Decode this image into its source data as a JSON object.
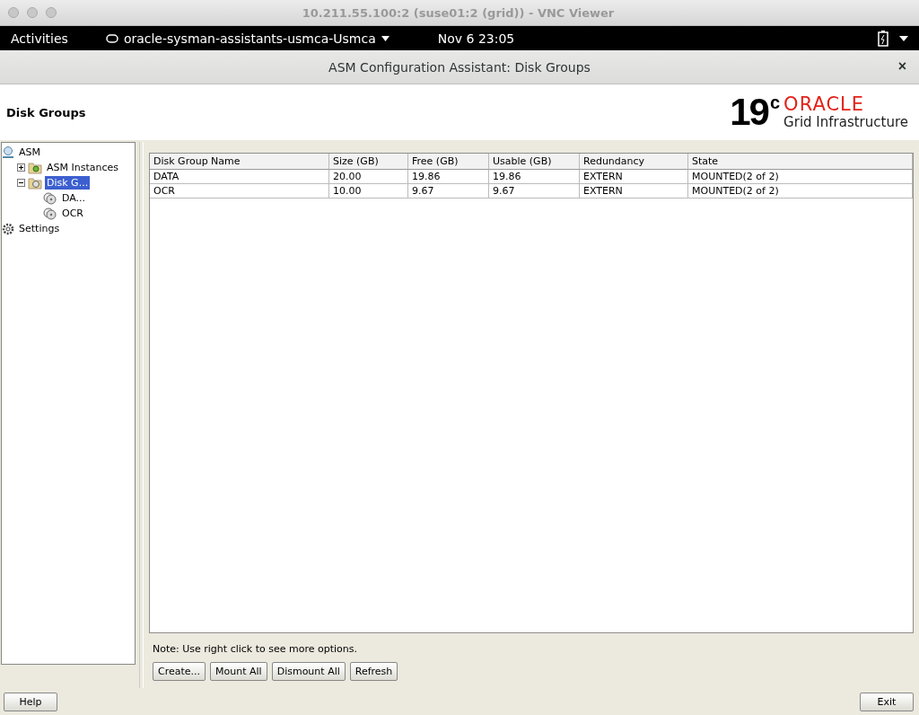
{
  "vnc_window": {
    "title": "10.211.55.100:2 (suse01:2 (grid)) - VNC Viewer"
  },
  "top_bar": {
    "activities": "Activities",
    "app_menu": "oracle-sysman-assistants-usmca-Usmca",
    "clock": "Nov 6  23:05"
  },
  "dialog": {
    "title": "ASM Configuration Assistant: Disk Groups",
    "close": "×"
  },
  "header": {
    "title": "Disk Groups",
    "logo": {
      "version": "19",
      "superscript": "c",
      "brand": "ORACLE",
      "product": "Grid Infrastructure"
    }
  },
  "tree": [
    {
      "label": "ASM",
      "kind": "server",
      "selected": false,
      "children": [
        {
          "label": "ASM Instances",
          "kind": "gear-folder",
          "selected": false,
          "expanded": false
        },
        {
          "label": "Disk G...",
          "kind": "disk-folder",
          "selected": true,
          "expanded": true,
          "children": [
            {
              "label": "DA...",
              "kind": "disk",
              "selected": false
            },
            {
              "label": "OCR",
              "kind": "disk",
              "selected": false
            }
          ]
        }
      ]
    },
    {
      "label": "Settings",
      "kind": "gear",
      "selected": false
    }
  ],
  "table": {
    "columns": [
      "Disk Group Name",
      "Size (GB)",
      "Free (GB)",
      "Usable (GB)",
      "Redundancy",
      "State"
    ],
    "rows": [
      [
        "DATA",
        "20.00",
        "19.86",
        "19.86",
        "EXTERN",
        "MOUNTED(2 of 2)"
      ],
      [
        "OCR",
        "10.00",
        "9.67",
        "9.67",
        "EXTERN",
        "MOUNTED(2 of 2)"
      ]
    ]
  },
  "note": "Note: Use right click to see more options.",
  "buttons": [
    "Create...",
    "Mount All",
    "Dismount All",
    "Refresh"
  ],
  "footer_buttons": [
    "Help",
    "Exit"
  ]
}
